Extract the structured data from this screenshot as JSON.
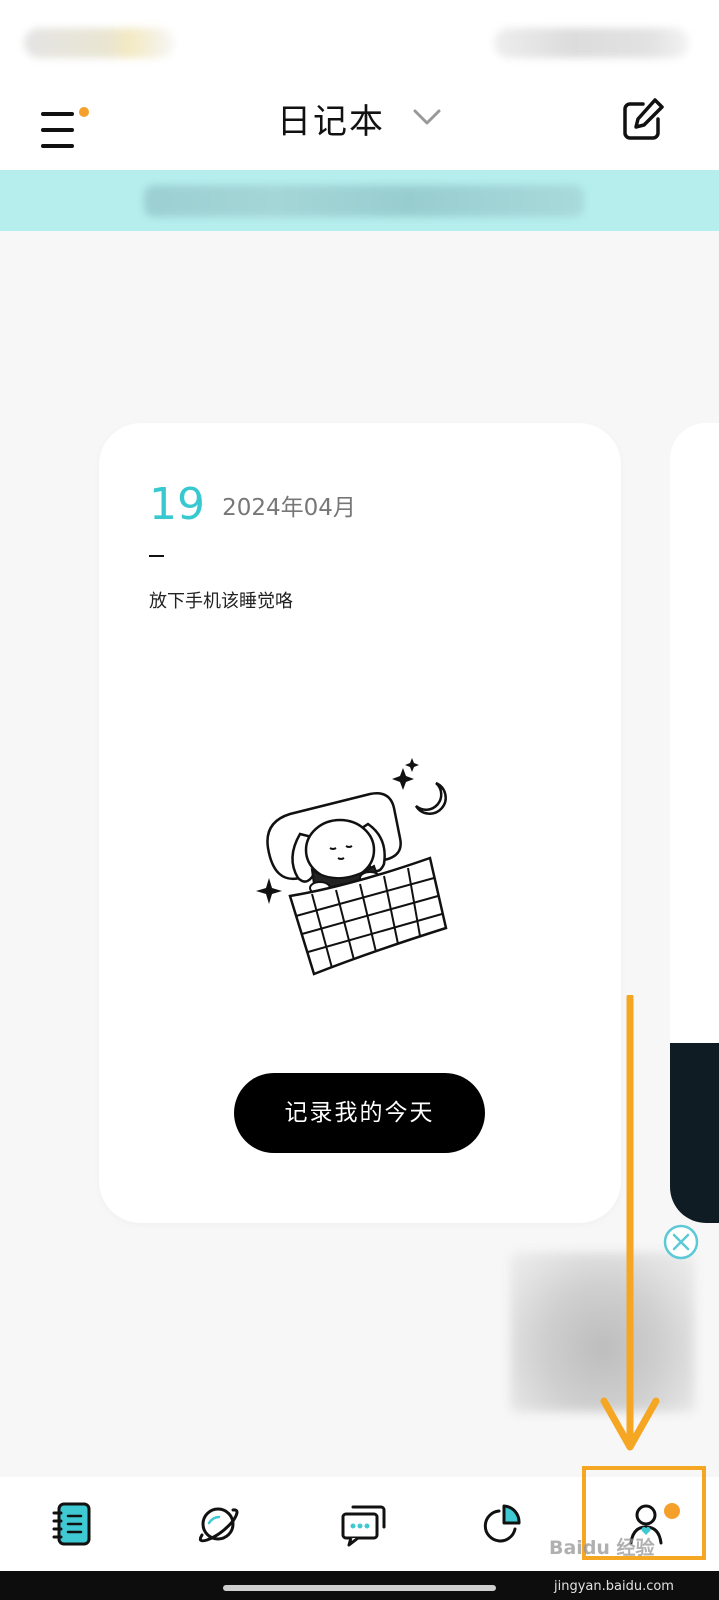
{
  "header": {
    "title": "日记本"
  },
  "diary_card": {
    "day": "19",
    "month": "2024年04月",
    "prompt": "放下手机该睡觉咯",
    "action_label": "记录我的今天"
  },
  "bottom_nav": {
    "items": [
      {
        "icon": "notebook-icon",
        "active": true
      },
      {
        "icon": "planet-icon",
        "active": false
      },
      {
        "icon": "chat-bubbles-icon",
        "active": false
      },
      {
        "icon": "pie-chart-icon",
        "active": false
      },
      {
        "icon": "profile-icon",
        "active": false,
        "badge": true
      }
    ]
  },
  "watermark": {
    "text": "Baidu 经验",
    "url": "jingyan.baidu.com"
  },
  "colors": {
    "accent": "#37c9cf",
    "banner": "#b6eeee",
    "badge": "#f5a02a",
    "annotation": "#f5a623"
  }
}
